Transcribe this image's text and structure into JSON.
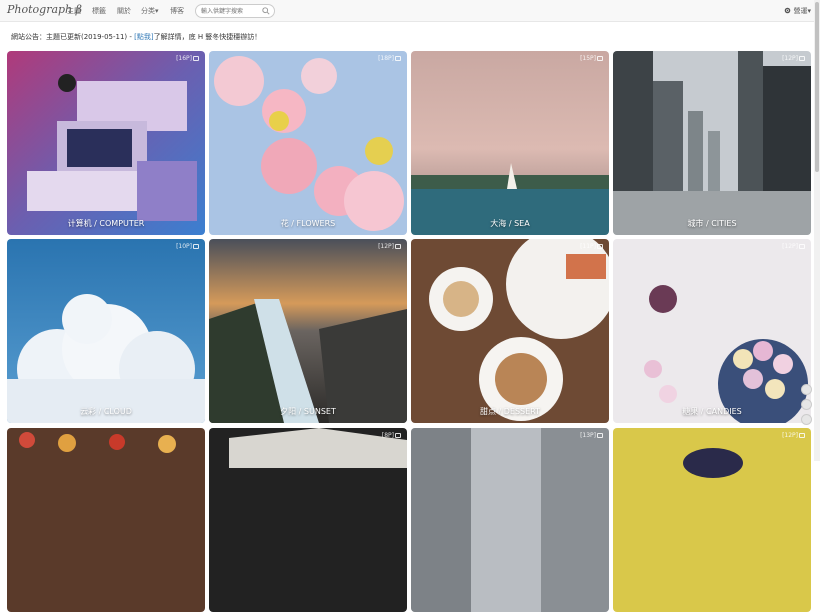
{
  "nav": {
    "brand": "Photograph β",
    "items": [
      "主題",
      "標籤",
      "關於",
      "分类▾",
      "博客"
    ],
    "search_placeholder": "輸入供鍵字搜索",
    "settings_label": "營運▾"
  },
  "notice": {
    "prefix": "網站公告：主題已更新(2019-05-11) - ",
    "link": "[點我]",
    "suffix": "了解詳情，底 H 豎冬快捷穩辦訪！"
  },
  "tiles": [
    {
      "label": "计算机 / COMPUTER",
      "count": "[16P]"
    },
    {
      "label": "花 / FLOWERS",
      "count": "[18P]"
    },
    {
      "label": "大海 / SEA",
      "count": "[15P]"
    },
    {
      "label": "城市 / CITIES",
      "count": "[12P]"
    },
    {
      "label": "云彩 / CLOUD",
      "count": "[10P]"
    },
    {
      "label": "夕阳 / SUNSET",
      "count": "[12P]"
    },
    {
      "label": "甜点 / DESSERT",
      "count": "[11P]"
    },
    {
      "label": "糖果 / CANDIES",
      "count": "[12P]"
    },
    {
      "label": "",
      "count": ""
    },
    {
      "label": "",
      "count": "[8P]"
    },
    {
      "label": "",
      "count": "[13P]"
    },
    {
      "label": "",
      "count": "[12P]"
    }
  ],
  "colors": {
    "link": "#337ab7",
    "navbar": "#f8f8f8"
  }
}
